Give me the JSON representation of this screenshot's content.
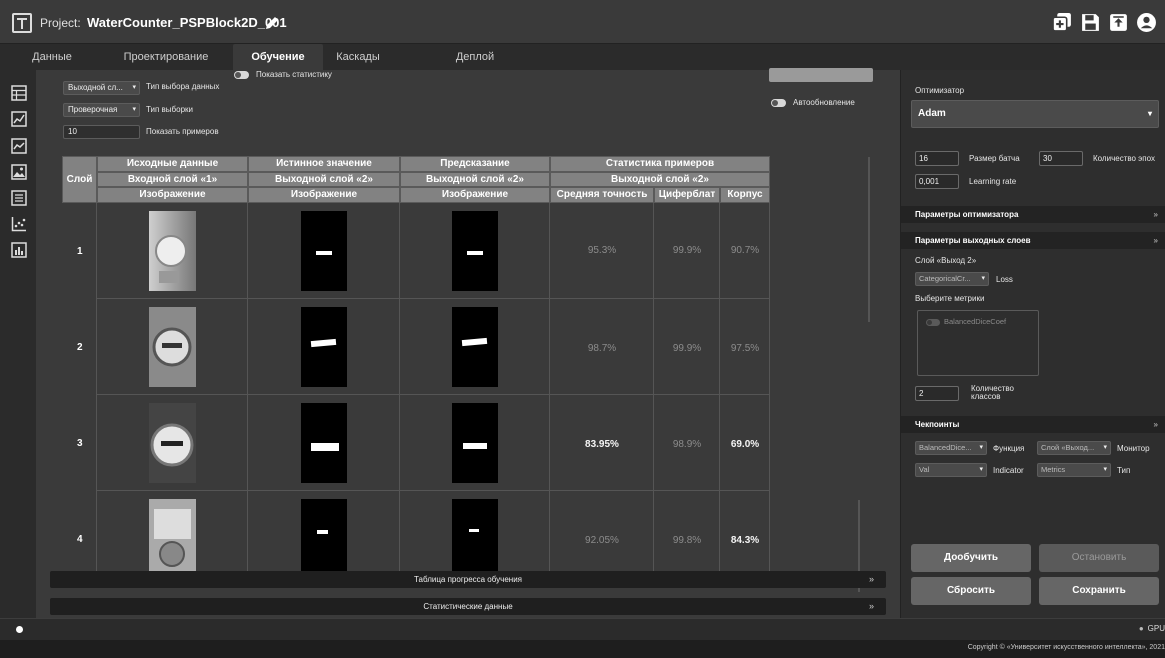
{
  "header": {
    "project_label": "Project:",
    "project_name": "WaterCounter_PSPBlock2D_001",
    "icons": [
      "edit-icon",
      "add-icon",
      "save-icon",
      "export-icon",
      "user-icon"
    ]
  },
  "tabs": [
    {
      "label": "Данные",
      "active": false
    },
    {
      "label": "Проектирование",
      "active": false
    },
    {
      "label": "Обучение",
      "active": true
    },
    {
      "label": "Каскады",
      "active": false
    },
    {
      "label": "Деплой",
      "active": false
    }
  ],
  "sidebar": {
    "icons": [
      "table-icon",
      "line-chart-icon",
      "line-chart-icon",
      "image-icon",
      "list-icon",
      "scatter-icon",
      "bar-chart-icon"
    ]
  },
  "controls": {
    "data_select_value": "Выходной сл...",
    "data_select_label": "Тип выбора данных",
    "sample_select_value": "Проверочная",
    "sample_select_label": "Тип выборки",
    "examples_value": "10",
    "examples_label": "Показать примеров",
    "show_stats_label": "Показать статистику",
    "autoupdate_label": "Автообновление"
  },
  "table": {
    "layer_header": "Слой",
    "group_headers": [
      "Исходные данные",
      "Истинное значение",
      "Предсказание",
      "Статистика примеров"
    ],
    "sub_headers": [
      "Входной слой «1»",
      "Выходной слой «2»",
      "Выходной слой «2»",
      "Выходной слой «2»"
    ],
    "type_headers": [
      "Изображение",
      "Изображение",
      "Изображение"
    ],
    "stat_headers": [
      "Средняя точность",
      "Циферблат",
      "Корпус"
    ],
    "rows": [
      {
        "layer": "1",
        "avg": "95.3%",
        "dial": "99.9%",
        "body": "90.7%",
        "avg_bright": false,
        "body_bright": false
      },
      {
        "layer": "2",
        "avg": "98.7%",
        "dial": "99.9%",
        "body": "97.5%",
        "avg_bright": false,
        "body_bright": false
      },
      {
        "layer": "3",
        "avg": "83.95%",
        "dial": "98.9%",
        "body": "69.0%",
        "avg_bright": true,
        "body_bright": true
      },
      {
        "layer": "4",
        "avg": "92.05%",
        "dial": "99.8%",
        "body": "84.3%",
        "avg_bright": false,
        "body_bright": true
      }
    ]
  },
  "accordions": {
    "progress": "Таблица прогресса обучения",
    "statistics": "Статистические данные"
  },
  "right_panel": {
    "optimizer_label": "Оптимизатор",
    "optimizer_value": "Adam",
    "batch_value": "16",
    "batch_label": "Размер батча",
    "epochs_value": "30",
    "epochs_label": "Количество эпох",
    "lr_value": "0,001",
    "lr_label": "Learning rate",
    "optimizer_params": "Параметры оптимизатора",
    "output_params": "Параметры выходных слоев",
    "layer_label": "Слой «Выход 2»",
    "loss_value": "CategoricalCr...",
    "loss_label": "Loss",
    "metrics_label": "Выберите метрики",
    "metric_item": "BalancedDiceCoef",
    "classes_value": "2",
    "classes_label": "Количество классов",
    "checkpoints": "Чекпоинты",
    "cp_func_value": "BalancedDice...",
    "cp_func_label": "Функция",
    "cp_monitor_value": "Слой «Выход...",
    "cp_monitor_label": "Монитор",
    "cp_val_value": "Val",
    "cp_indicator_label": "Indicator",
    "cp_metrics_value": "Metrics",
    "cp_type_label": "Тип",
    "btn_train": "Дообучить",
    "btn_stop": "Остановить",
    "btn_reset": "Сбросить",
    "btn_save": "Сохранить"
  },
  "status": {
    "gpu": "GPU"
  },
  "footer": {
    "copyright": "Copyright © «Университет искусственного интеллекта», 2021"
  }
}
